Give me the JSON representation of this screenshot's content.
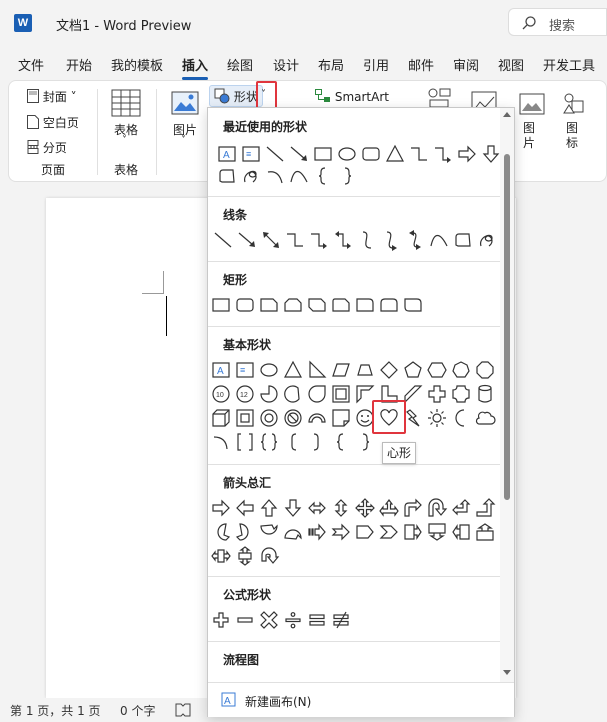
{
  "titlebar": {
    "logo": "W",
    "title": "文档1  -  Word Preview",
    "search_placeholder": "搜索"
  },
  "menu": {
    "tabs": [
      "文件",
      "开始",
      "我的模板",
      "插入",
      "绘图",
      "设计",
      "布局",
      "引用",
      "邮件",
      "审阅",
      "视图",
      "开发工具"
    ],
    "active": "插入"
  },
  "ribbon": {
    "cover": "封面",
    "blank_page": "空白页",
    "page_break": "分页",
    "group_pages": "页面",
    "table": "表格",
    "group_table": "表格",
    "picture": "图片",
    "shapes": "形状",
    "smartart": "SmartArt",
    "picture2": "图片",
    "icons": "图标"
  },
  "panel": {
    "sections": [
      "最近使用的形状",
      "线条",
      "矩形",
      "基本形状",
      "箭头总汇",
      "公式形状",
      "流程图"
    ],
    "new_canvas": "新建画布(N)",
    "tooltip": "心形"
  },
  "status": {
    "page": "第 1 页，共 1 页",
    "words": "0 个字"
  },
  "colors": {
    "accent": "#1a5fb4",
    "highlight": "#e0353d"
  }
}
